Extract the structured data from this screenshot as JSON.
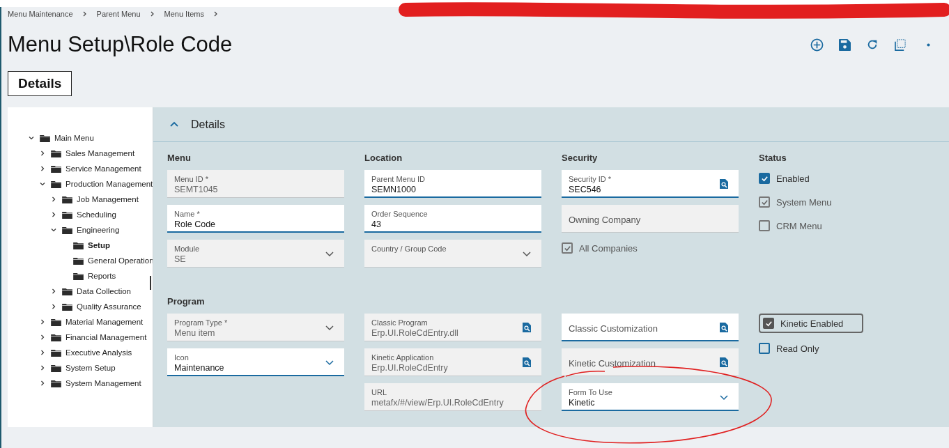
{
  "breadcrumb": [
    "Menu Maintenance",
    "Parent Menu",
    "Menu Items"
  ],
  "title": "Menu Setup\\Role Code",
  "tabs": [
    {
      "label": "Details",
      "selected": true
    }
  ],
  "tree": [
    {
      "label": "Main Menu",
      "expanded": true,
      "selected": false,
      "children": [
        {
          "label": "Sales Management",
          "expanded": false,
          "selected": false
        },
        {
          "label": "Service Management",
          "expanded": false,
          "selected": false
        },
        {
          "label": "Production Management",
          "expanded": true,
          "selected": false,
          "children": [
            {
              "label": "Job Management",
              "expanded": false,
              "selected": false
            },
            {
              "label": "Scheduling",
              "expanded": false,
              "selected": false
            },
            {
              "label": "Engineering",
              "expanded": true,
              "selected": false,
              "children": [
                {
                  "label": "Setup",
                  "selected": true
                },
                {
                  "label": "General Operation",
                  "selected": false
                },
                {
                  "label": "Reports",
                  "selected": false
                }
              ]
            },
            {
              "label": "Data Collection",
              "expanded": false,
              "selected": false
            },
            {
              "label": "Quality Assurance",
              "expanded": false,
              "selected": false
            }
          ]
        },
        {
          "label": "Material Management",
          "expanded": false,
          "selected": false
        },
        {
          "label": "Financial Management",
          "expanded": false,
          "selected": false
        },
        {
          "label": "Executive Analysis",
          "expanded": false,
          "selected": false
        },
        {
          "label": "System Setup",
          "expanded": false,
          "selected": false
        },
        {
          "label": "System Management",
          "expanded": false,
          "selected": false
        }
      ]
    }
  ],
  "panel": {
    "title": "Details",
    "expanded": true,
    "sections": [
      {
        "columns": [
          {
            "heading": "Menu",
            "items": [
              {
                "kind": "text",
                "label": "Menu ID *",
                "value": "SEMT1045",
                "editable": false
              },
              {
                "kind": "text",
                "label": "Name *",
                "value": "Role Code",
                "editable": true
              },
              {
                "kind": "select",
                "label": "Module",
                "value": "SE",
                "editable": false
              }
            ]
          },
          {
            "heading": "Location",
            "items": [
              {
                "kind": "text",
                "label": "Parent Menu ID",
                "value": "SEMN1000",
                "editable": true
              },
              {
                "kind": "text",
                "label": "Order Sequence",
                "value": "43",
                "editable": true
              },
              {
                "kind": "select",
                "label": "Country / Group Code",
                "editable": false
              }
            ]
          },
          {
            "heading": "Security",
            "items": [
              {
                "kind": "lookup",
                "label": "Security ID *",
                "value": "SEC546",
                "editable": true
              },
              {
                "kind": "text",
                "placeholder": "Owning Company",
                "editable": false
              },
              {
                "kind": "checkbox",
                "label": "All Companies",
                "checked": true,
                "disabled": true,
                "focused": false
              }
            ]
          },
          {
            "heading": "Status",
            "items": [
              {
                "kind": "checkbox",
                "label": "Enabled",
                "checked": true,
                "disabled": false,
                "focused": false
              },
              {
                "kind": "checkbox",
                "label": "System Menu",
                "checked": true,
                "disabled": true,
                "focused": false
              },
              {
                "kind": "checkbox",
                "label": "CRM Menu",
                "checked": false,
                "disabled": true,
                "focused": false
              }
            ]
          }
        ]
      },
      {
        "heading": "Program",
        "columns": [
          {
            "items": [
              {
                "kind": "select",
                "label": "Program Type *",
                "value": "Menu item",
                "editable": false
              },
              {
                "kind": "select",
                "label": "Icon",
                "value": "Maintenance",
                "editable": true
              }
            ]
          },
          {
            "items": [
              {
                "kind": "lookup",
                "label": "Classic Program",
                "value": "Erp.UI.RoleCdEntry.dll",
                "editable": false
              },
              {
                "kind": "lookup",
                "label": "Kinetic Application",
                "value": "Erp.UI.RoleCdEntry",
                "editable": false
              },
              {
                "kind": "text",
                "label": "URL",
                "value": "metafx/#/view/Erp.UI.RoleCdEntry",
                "editable": false
              }
            ]
          },
          {
            "items": [
              {
                "kind": "lookup",
                "placeholder": "Classic Customization",
                "editable": true
              },
              {
                "kind": "lookup",
                "placeholder": "Kinetic Customization",
                "editable": false
              },
              {
                "kind": "select",
                "label": "Form To Use",
                "value": "Kinetic",
                "editable": true
              }
            ]
          },
          {
            "items": [
              {
                "kind": "checkbox",
                "label": "Kinetic Enabled",
                "checked": true,
                "disabled": false,
                "focused": true
              },
              {
                "kind": "checkbox",
                "label": "Read Only",
                "checked": false,
                "disabled": false,
                "focused": false
              }
            ]
          }
        ]
      }
    ]
  }
}
